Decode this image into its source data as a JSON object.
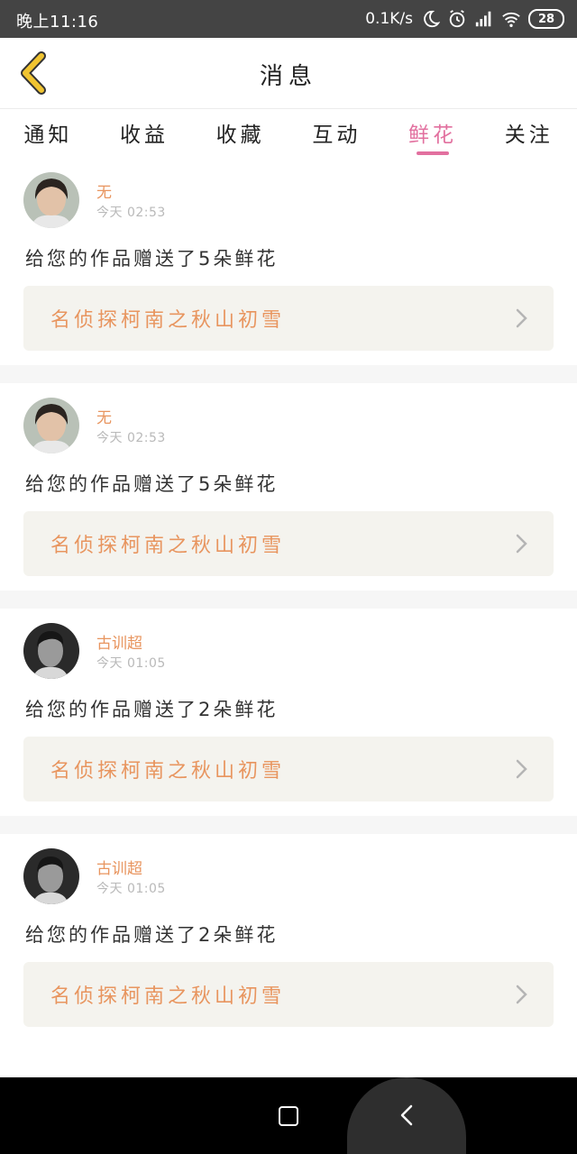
{
  "status_bar": {
    "time": "晚上11:16",
    "net_speed": "0.1K/s",
    "battery": "28",
    "icons": [
      "moon-icon",
      "alarm-icon",
      "signal-icon",
      "wifi-icon",
      "battery-icon"
    ]
  },
  "header": {
    "title": "消息",
    "back_icon": "chevron-left-icon"
  },
  "tabs": [
    {
      "label": "通知",
      "active": false
    },
    {
      "label": "收益",
      "active": false
    },
    {
      "label": "收藏",
      "active": false
    },
    {
      "label": "互动",
      "active": false
    },
    {
      "label": "鲜花",
      "active": true
    },
    {
      "label": "关注",
      "active": false
    }
  ],
  "feed": [
    {
      "username": "无",
      "time": "今天 02:53",
      "message": "给您的作品赠送了5朵鲜花",
      "work_title": "名侦探柯南之秋山初雪"
    },
    {
      "username": "无",
      "time": "今天 02:53",
      "message": "给您的作品赠送了5朵鲜花",
      "work_title": "名侦探柯南之秋山初雪"
    },
    {
      "username": "古训超",
      "time": "今天 01:05",
      "message": "给您的作品赠送了2朵鲜花",
      "work_title": "名侦探柯南之秋山初雪"
    },
    {
      "username": "古训超",
      "time": "今天 01:05",
      "message": "给您的作品赠送了2朵鲜花",
      "work_title": "名侦探柯南之秋山初雪"
    }
  ],
  "colors": {
    "accent_pink": "#e2709f",
    "accent_orange": "#e8955f",
    "back_arrow": "#f0c431",
    "status_bar_bg": "#444444"
  },
  "nav_icons": [
    "recent-apps-icon",
    "back-icon"
  ]
}
